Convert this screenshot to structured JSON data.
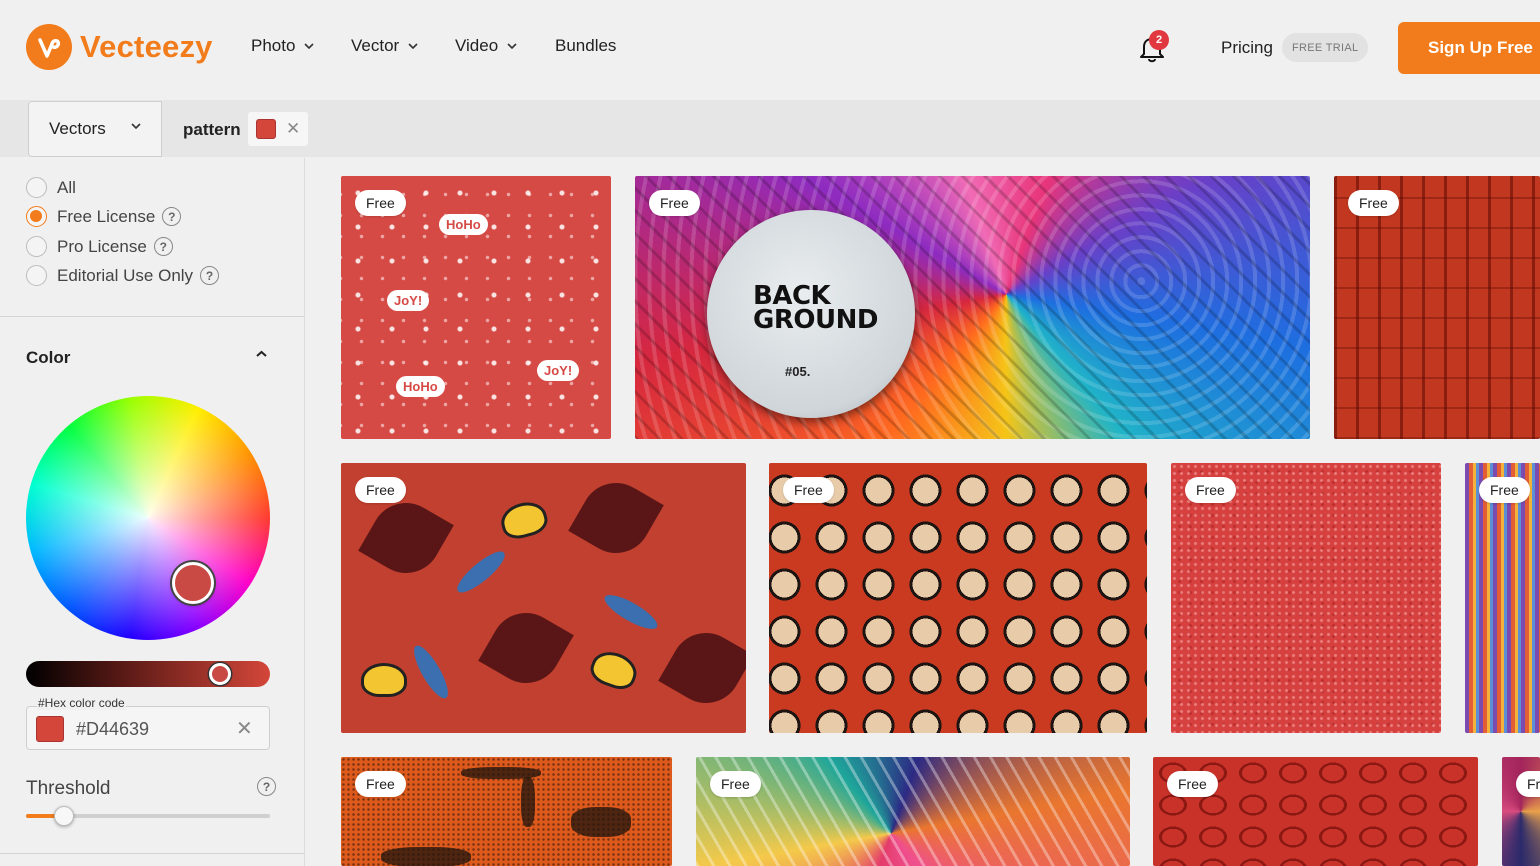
{
  "brand": {
    "name": "Vecteezy",
    "accent": "#f27c1b"
  },
  "nav": {
    "items": [
      {
        "label": "Photo",
        "has_dropdown": true
      },
      {
        "label": "Vector",
        "has_dropdown": true
      },
      {
        "label": "Video",
        "has_dropdown": true
      },
      {
        "label": "Bundles",
        "has_dropdown": false
      }
    ],
    "notifications_count": "2",
    "pricing": "Pricing",
    "trial_badge": "FREE TRIAL",
    "signup": "Sign Up Free"
  },
  "search": {
    "type": "Vectors",
    "query": "pattern",
    "color_filter": "#D44639"
  },
  "sidebar": {
    "license_options": [
      {
        "label": "All",
        "selected": false,
        "help": false
      },
      {
        "label": "Free License",
        "selected": true,
        "help": true
      },
      {
        "label": "Pro License",
        "selected": false,
        "help": true
      },
      {
        "label": "Editorial Use Only",
        "selected": false,
        "help": true
      }
    ],
    "color": {
      "heading": "Color",
      "hex_label": "#Hex color code",
      "hex_value": "#D44639",
      "swatch": "#d44639"
    },
    "threshold": {
      "label": "Threshold",
      "value_fraction": 0.15
    }
  },
  "results": {
    "badge": "Free",
    "tiles": [
      {
        "id": "christmas-pattern",
        "disc_title": "",
        "hoho": "HoHo",
        "joy": "JoY!"
      },
      {
        "id": "abstract-background",
        "disc_title_1": "BACK",
        "disc_title_2": "GROUND",
        "disc_number": "#05."
      },
      {
        "id": "red-lattice"
      },
      {
        "id": "butterfly-lily-pattern"
      },
      {
        "id": "octagon-dots"
      },
      {
        "id": "red-floral-texture"
      },
      {
        "id": "stripes"
      },
      {
        "id": "orange-grunge"
      },
      {
        "id": "colorful-shapes"
      },
      {
        "id": "red-tile-pattern"
      },
      {
        "id": "partial-tile"
      }
    ]
  }
}
